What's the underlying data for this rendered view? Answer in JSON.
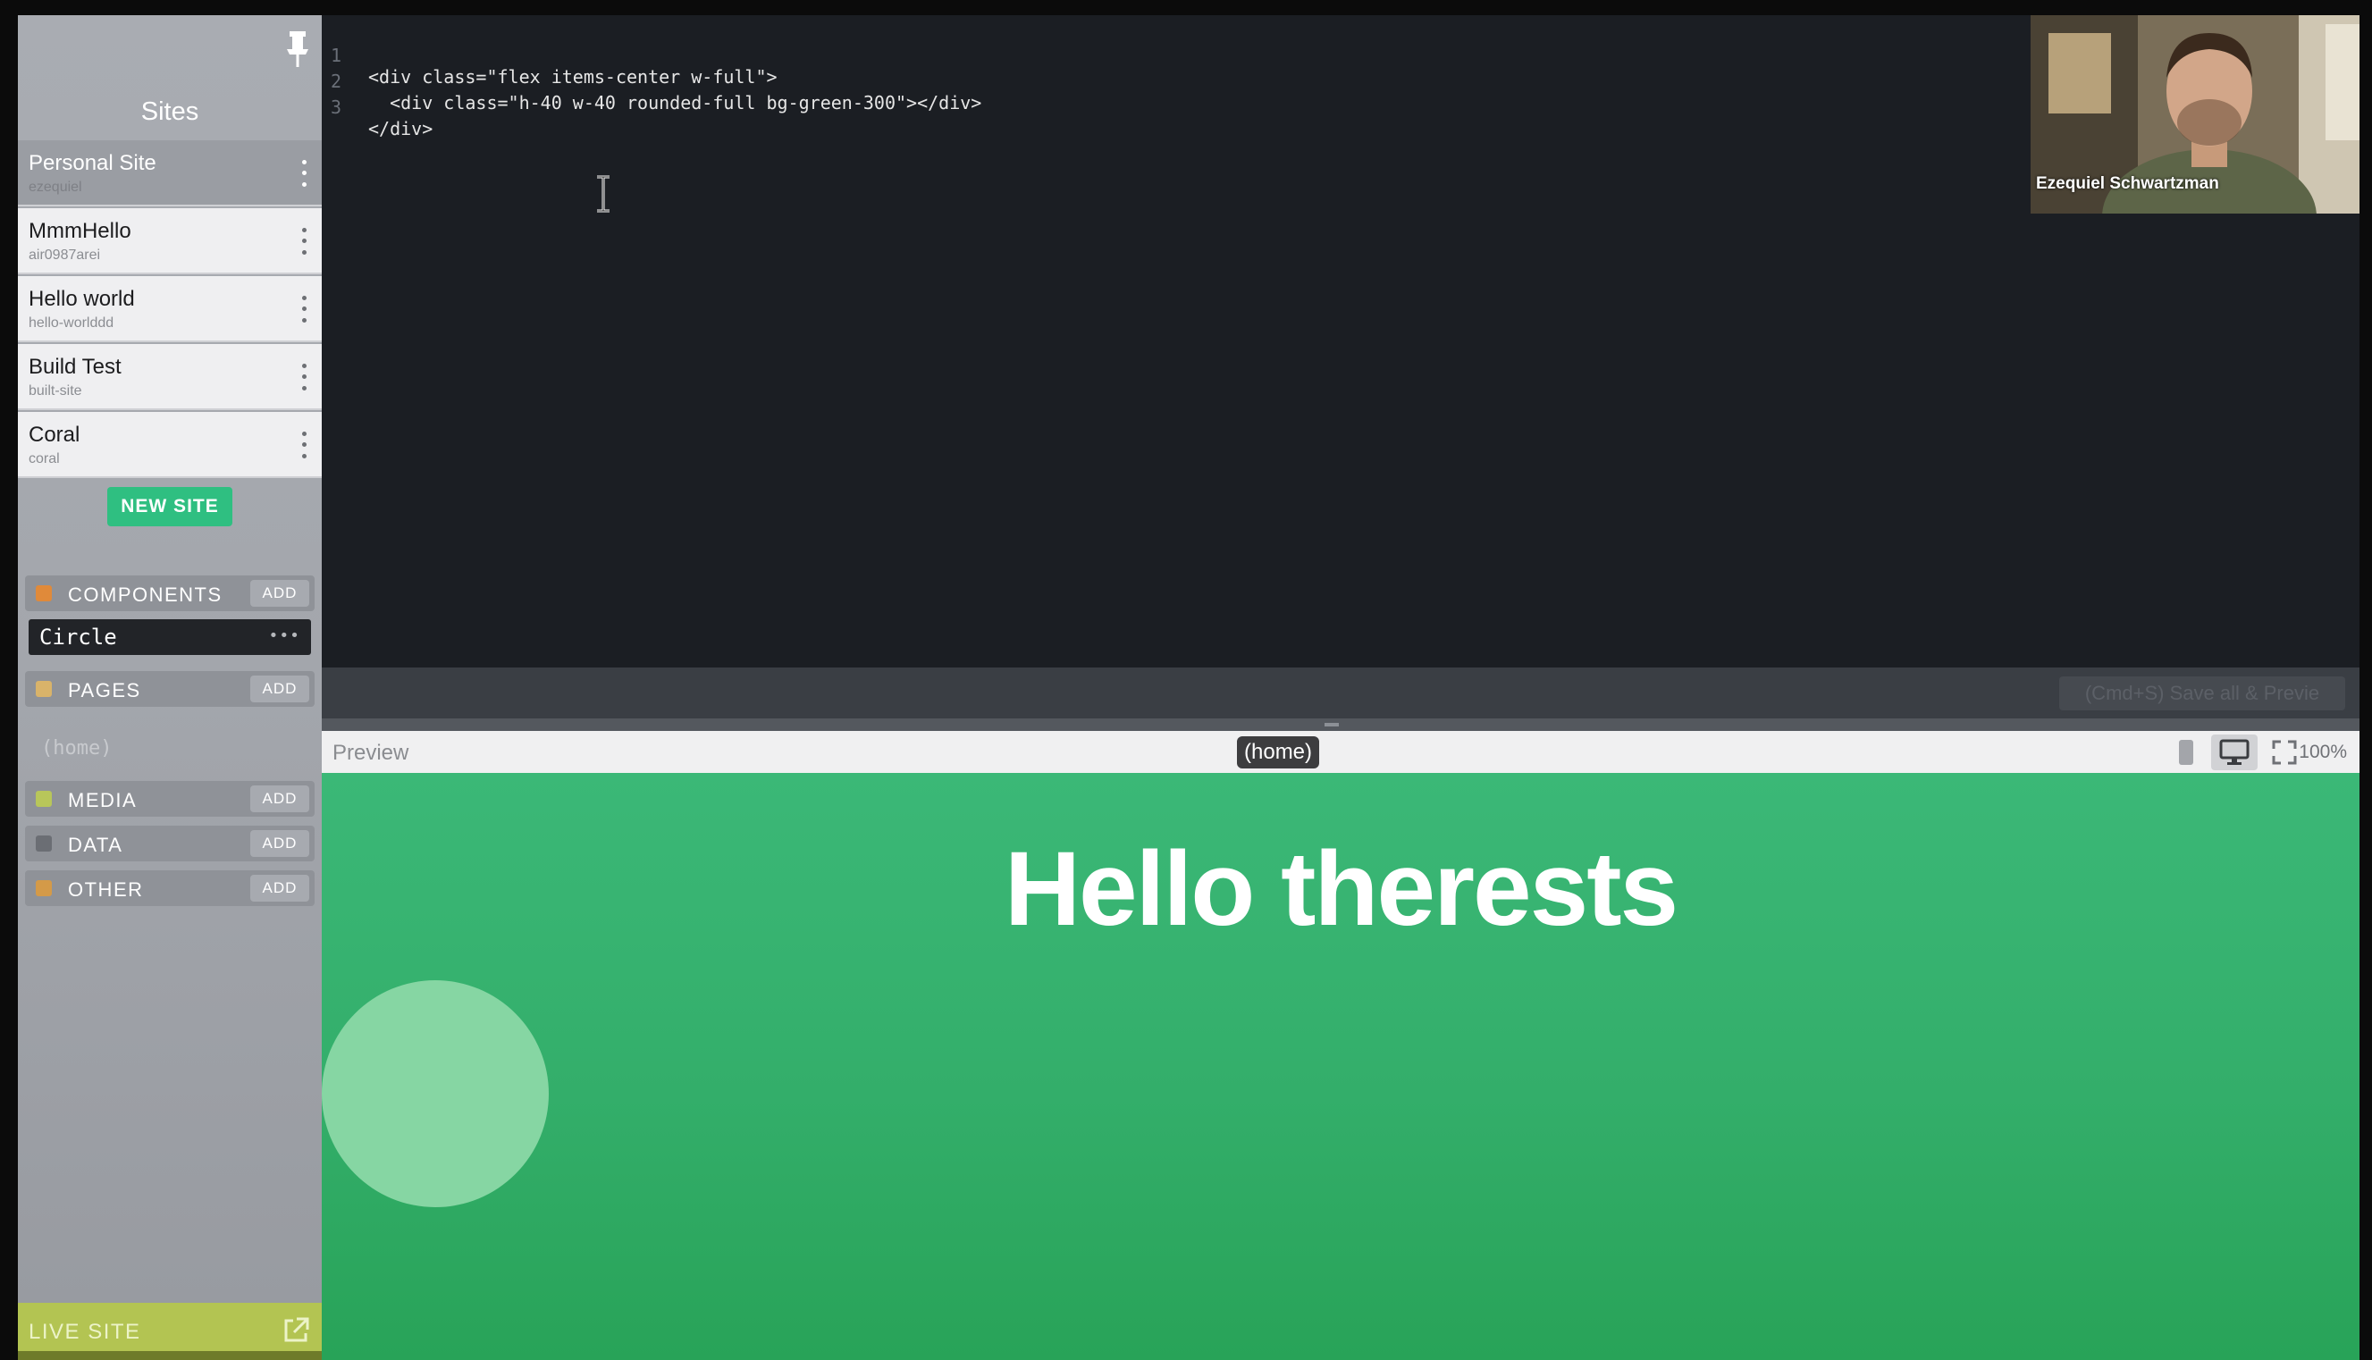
{
  "sidebar": {
    "title": "Sites",
    "sites": [
      {
        "name": "Personal Site",
        "slug": "ezequiel",
        "active": true
      },
      {
        "name": "MmmHello",
        "slug": "air0987arei",
        "active": false
      },
      {
        "name": "Hello world",
        "slug": "hello-worlddd",
        "active": false
      },
      {
        "name": "Build Test",
        "slug": "built-site",
        "active": false
      },
      {
        "name": "Coral",
        "slug": "coral",
        "active": false
      }
    ],
    "new_site_label": "NEW SITE",
    "sections": {
      "components": {
        "label": "COMPONENTS",
        "add_label": "ADD",
        "items": [
          "Circle"
        ],
        "more": "•••"
      },
      "pages": {
        "label": "PAGES",
        "add_label": "ADD",
        "items": [
          "(home)"
        ]
      },
      "media": {
        "label": "MEDIA",
        "add_label": "ADD"
      },
      "data": {
        "label": "DATA",
        "add_label": "ADD"
      },
      "other": {
        "label": "OTHER",
        "add_label": "ADD"
      }
    },
    "live_site_label": "LIVE SITE"
  },
  "editor": {
    "lines": [
      {
        "num": "1",
        "text": "<div class=\"flex items-center w-full\">"
      },
      {
        "num": "2",
        "text": "  <div class=\"h-40 w-40 rounded-full bg-green-300\"></div>"
      },
      {
        "num": "3",
        "text": "</div>"
      }
    ],
    "save_hint": "(Cmd+S) Save all & Previe"
  },
  "preview": {
    "label": "Preview",
    "route": "(home)",
    "zoom": "100%",
    "heading": "Hello therests"
  },
  "webcam": {
    "name": "Ezequiel Schwartzman"
  },
  "colors": {
    "accent_green": "#2fbf81",
    "preview_green": "#33ae6a",
    "circle_green": "#86d6a3",
    "live_site_bar": "#b3c452"
  },
  "icons": [
    "pin-icon",
    "kebab-menu-icon",
    "components-icon",
    "pages-icon",
    "media-icon",
    "data-icon",
    "other-icon",
    "external-link-icon",
    "text-cursor-icon",
    "mobile-icon",
    "desktop-icon",
    "fullscreen-icon"
  ]
}
